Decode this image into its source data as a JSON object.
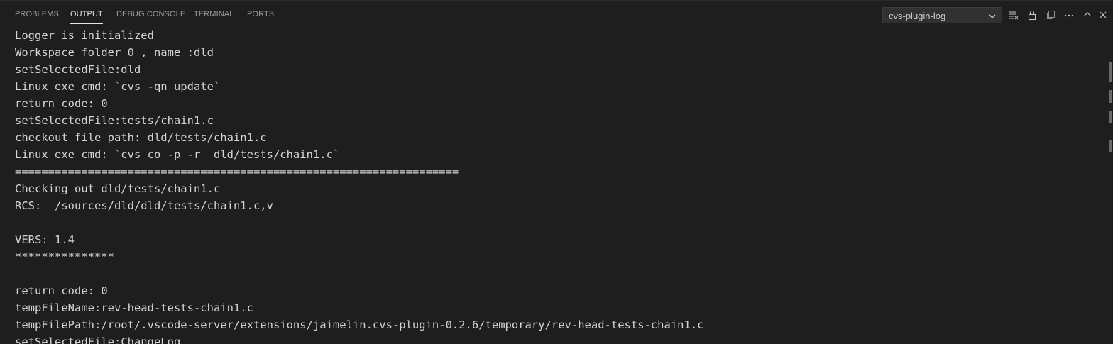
{
  "tabs": [
    {
      "label": "PROBLEMS"
    },
    {
      "label": "OUTPUT"
    },
    {
      "label": "DEBUG CONSOLE"
    },
    {
      "label": "TERMINAL"
    },
    {
      "label": "PORTS"
    }
  ],
  "active_tab": "OUTPUT",
  "channel_select": {
    "selected": "cvs-plugin-log"
  },
  "toolbar_icons": [
    "clear-output-icon",
    "lock-scroll-icon",
    "copy-icon",
    "more-actions-icon",
    "maximize-panel-icon",
    "close-panel-icon"
  ],
  "output_lines": [
    "Logger is initialized",
    "Workspace folder 0 , name :dld",
    "setSelectedFile:dld",
    "Linux exe cmd: `cvs -qn update`",
    "return code: 0",
    "setSelectedFile:tests/chain1.c",
    "checkout file path: dld/tests/chain1.c",
    "Linux exe cmd: `cvs co -p -r  dld/tests/chain1.c`",
    "===================================================================",
    "Checking out dld/tests/chain1.c",
    "RCS:  /sources/dld/dld/tests/chain1.c,v",
    "",
    "VERS: 1.4",
    "***************",
    "",
    "return code: 0",
    "tempFileName:rev-head-tests-chain1.c",
    "tempFilePath:/root/.vscode-server/extensions/jaimelin.cvs-plugin-0.2.6/temporary/rev-head-tests-chain1.c",
    "setSelectedFile:ChangeLog"
  ]
}
